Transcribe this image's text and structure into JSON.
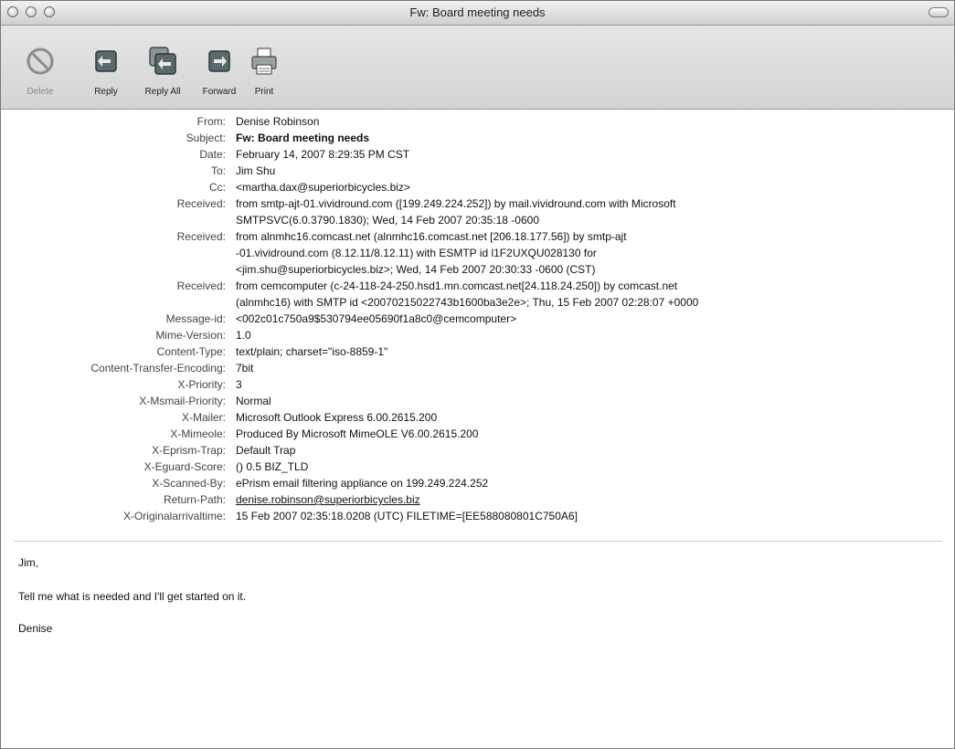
{
  "window": {
    "title": "Fw: Board meeting needs"
  },
  "toolbar": {
    "buttons": [
      {
        "label": "Delete",
        "icon": "delete-icon",
        "enabled": false
      },
      {
        "label": "Reply",
        "icon": "reply-icon",
        "enabled": true
      },
      {
        "label": "Reply All",
        "icon": "reply-all-icon",
        "enabled": true
      },
      {
        "label": "Forward",
        "icon": "forward-icon",
        "enabled": true
      },
      {
        "label": "Print",
        "icon": "printer-icon",
        "enabled": true
      }
    ]
  },
  "headers": [
    {
      "label": "From:",
      "lines": [
        "Denise Robinson"
      ]
    },
    {
      "label": "Subject:",
      "lines": [
        "Fw: Board meeting needs"
      ]
    },
    {
      "label": "Date:",
      "lines": [
        "February 14, 2007 8:29:35 PM CST"
      ]
    },
    {
      "label": "To:",
      "lines": [
        "Jim Shu"
      ]
    },
    {
      "label": "Cc:",
      "lines": [
        "<martha.dax@superiorbicycles.biz>"
      ]
    },
    {
      "label": "Received:",
      "lines": [
        "from smtp-ajt-01.vividround.com ([199.249.224.252]) by mail.vividround.com with Microsoft",
        "SMTPSVC(6.0.3790.1830); Wed, 14 Feb 2007 20:35:18 -0600"
      ]
    },
    {
      "label": "Received:",
      "lines": [
        "from alnmhc16.comcast.net (alnmhc16.comcast.net [206.18.177.56]) by smtp-ajt",
        "-01.vividround.com (8.12.11/8.12.11) with ESMTP id l1F2UXQU028130 for",
        "<jim.shu@superiorbicycles.biz>; Wed, 14 Feb 2007 20:30:33 -0600 (CST)"
      ]
    },
    {
      "label": "Received:",
      "lines": [
        "from cemcomputer (c-24-118-24-250.hsd1.mn.comcast.net[24.118.24.250]) by comcast.net",
        "(alnmhc16) with SMTP id <20070215022743b1600ba3e2e>; Thu, 15 Feb 2007 02:28:07 +0000"
      ]
    },
    {
      "label": "Message-id:",
      "lines": [
        "<002c01c750a9$530794ee05690f1a8c0@cemcomputer>"
      ]
    },
    {
      "label": "Mime-Version:",
      "lines": [
        "1.0"
      ]
    },
    {
      "label": "Content-Type:",
      "lines": [
        "text/plain; charset=\"iso-8859-1\""
      ]
    },
    {
      "label": "Content-Transfer-Encoding:",
      "lines": [
        "7bit"
      ]
    },
    {
      "label": "X-Priority:",
      "lines": [
        "3"
      ]
    },
    {
      "label": "X-Msmail-Priority:",
      "lines": [
        "Normal"
      ]
    },
    {
      "label": "X-Mailer:",
      "lines": [
        "Microsoft Outlook Express 6.00.2615.200"
      ]
    },
    {
      "label": "X-Mimeole:",
      "lines": [
        "Produced By Microsoft MimeOLE V6.00.2615.200"
      ]
    },
    {
      "label": "X-Eprism-Trap:",
      "lines": [
        "Default Trap"
      ]
    },
    {
      "label": "X-Eguard-Score:",
      "lines": [
        "() 0.5 BIZ_TLD"
      ]
    },
    {
      "label": "X-Scanned-By:",
      "lines": [
        "ePrism email filtering appliance on 199.249.224.252"
      ]
    },
    {
      "label": "Return-Path:",
      "lines": [
        "denise.robinson@superiorbicycles.biz"
      ]
    },
    {
      "label": "X-Originalarrivaltime:",
      "lines": [
        "15 Feb 2007 02:35:18.0208 (UTC) FILETIME=[EE588080801C750A6]"
      ]
    }
  ],
  "body": {
    "greeting": "Jim,",
    "message": "Tell me what is needed and I'll get started on it.",
    "signature": "Denise"
  }
}
